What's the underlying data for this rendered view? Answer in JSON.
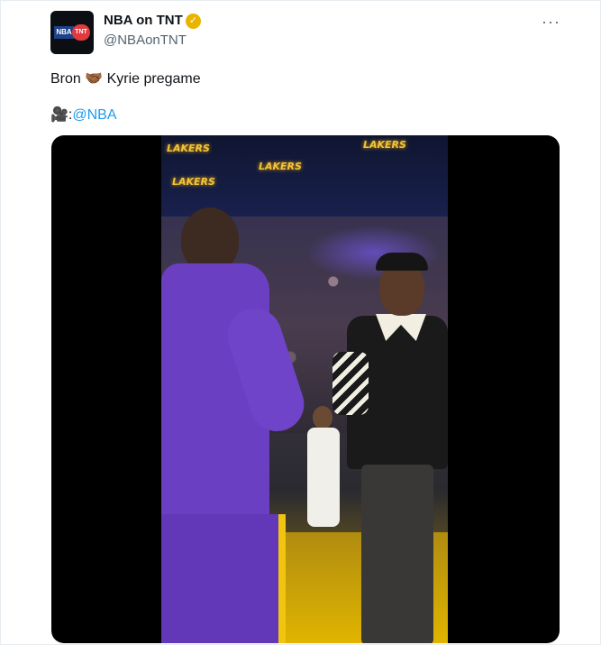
{
  "tweet": {
    "author_name": "NBA on TNT",
    "handle": "@NBAonTNT",
    "verified_color": "#e8b400",
    "more_label": "···",
    "text_line1": "Bron 🤝🏾 Kyrie pregame",
    "credit_prefix": "🎥: ",
    "credit_mention": "@NBA"
  },
  "avatar": {
    "left_text": "NBA",
    "right_text": "TNT"
  },
  "video": {
    "arena_banners": [
      "LAKERS",
      "LAKERS",
      "LAKERS",
      "LAKERS"
    ]
  },
  "colors": {
    "mention": "#1d9bf0",
    "secondary_text": "#536471",
    "lakers_purple": "#6a3fc2",
    "lakers_gold": "#f3c33a"
  }
}
